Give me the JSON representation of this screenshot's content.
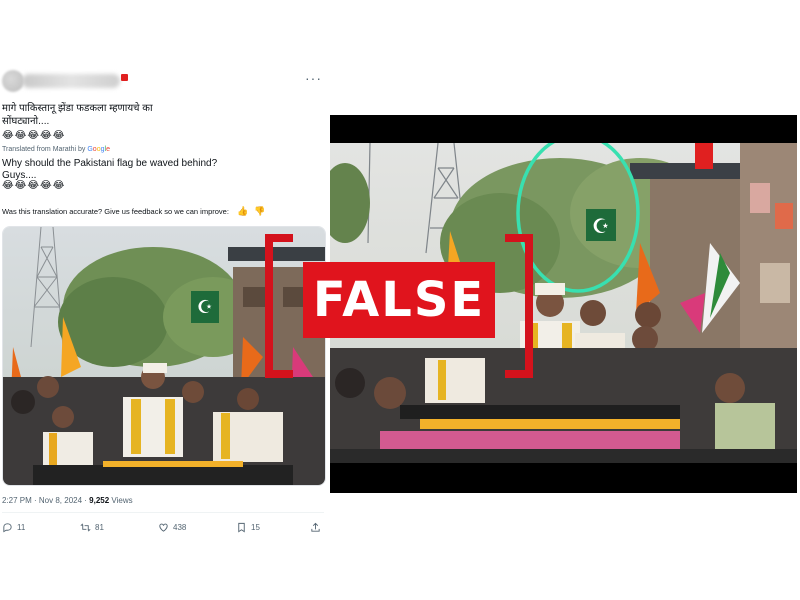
{
  "tweet": {
    "line1": "मागे पाकिस्तानू झेंडा फडकला म्हणायचे का",
    "line2": "सोंघट्यानो....",
    "emoji1": "😂😂😂😂😂",
    "translated_prefix": "Translated from Marathi by ",
    "google": [
      "G",
      "o",
      "o",
      "g",
      "l",
      "e"
    ],
    "line3": "Why should the Pakistani flag be waved behind?",
    "line4": "Guys....",
    "emoji2": "😂😂😂😂😂",
    "feedback": "Was this translation accurate? Give us feedback so we can improve:",
    "time": "2:27 PM · Nov 8, 2024 · ",
    "views_count": "9,252",
    "views_label": " Views",
    "replies": "11",
    "reposts": "81",
    "likes": "438",
    "bookmarks": "15"
  },
  "stamp": {
    "label": "FALSE"
  },
  "colors": {
    "stamp_red": "#e0141d",
    "circle": "#38e0b0",
    "pak_flag": "#1e6b3a"
  },
  "icons": [
    "more-icon",
    "thumbs-up-icon",
    "thumbs-down-icon",
    "reply-icon",
    "repost-icon",
    "like-icon",
    "bookmark-icon",
    "share-icon"
  ]
}
